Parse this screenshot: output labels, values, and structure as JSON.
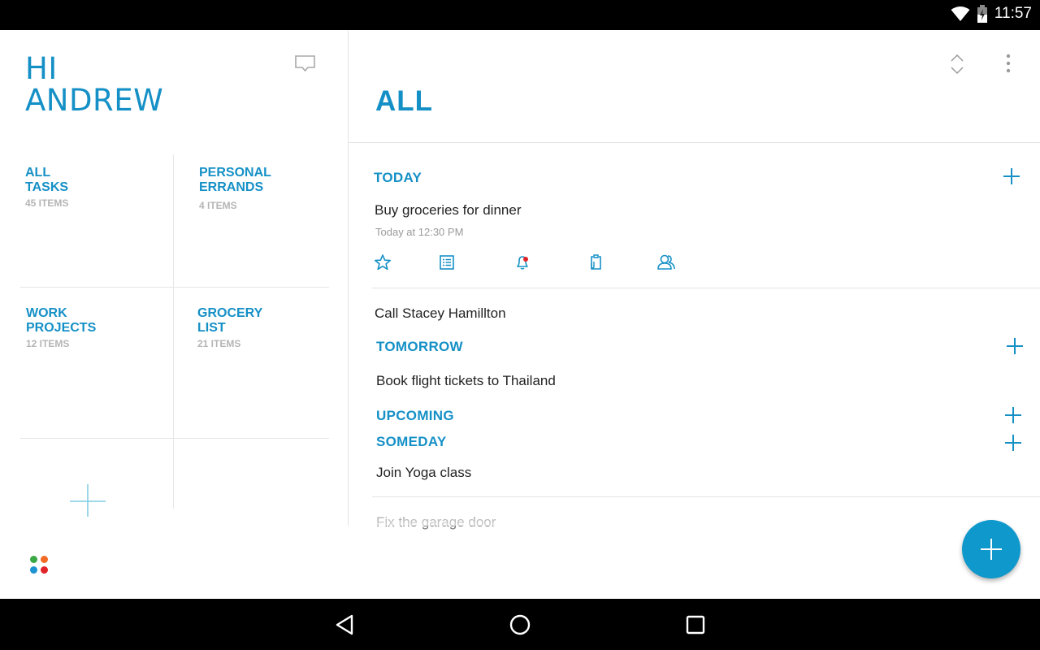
{
  "status_bar": {
    "time": "11:57",
    "icons": [
      "wifi-icon",
      "battery-charging-icon"
    ]
  },
  "sidebar": {
    "greeting": "HI\nANDREW",
    "chat_icon": "chat-bubble-icon",
    "lists": [
      {
        "title": "ALL\nTASKS",
        "count": "45 ITEMS"
      },
      {
        "title": "PERSONAL\nERRANDS",
        "count": "4 ITEMS"
      },
      {
        "title": "WORK\nPROJECTS",
        "count": "12 ITEMS"
      },
      {
        "title": "GROCERY\nLIST",
        "count": "21 ITEMS"
      }
    ],
    "add_list_icon": "plus-icon",
    "apps_icon": "four-dots-icon",
    "dot_colors": [
      "#3aa845",
      "#f26a26",
      "#1d93d2",
      "#e12228"
    ]
  },
  "main": {
    "title": "ALL",
    "header_icons": [
      "collapse-expand-icon",
      "more-vert-icon"
    ],
    "sections": [
      {
        "title": "TODAY"
      },
      {
        "title": "TOMORROW"
      },
      {
        "title": "UPCOMING"
      },
      {
        "title": "SOMEDAY"
      }
    ],
    "tasks": {
      "buy_groceries": {
        "title": "Buy groceries for dinner",
        "due": "Today at 12:30 PM"
      },
      "call_stacey": {
        "title": "Call Stacey Hamillton"
      },
      "book_flight": {
        "title": "Book flight tickets to Thailand"
      },
      "join_yoga": {
        "title": "Join Yoga class"
      },
      "fix_garage": {
        "title": "Fix the garage door"
      }
    },
    "task_actions": [
      "star-icon",
      "subtasks-icon",
      "reminder-icon",
      "attachment-icon",
      "share-icon"
    ],
    "fab_icon": "plus-icon"
  },
  "colors": {
    "accent": "#1590c6",
    "fab": "#0f98cc",
    "reminder_dot": "#e12228"
  },
  "nav_bar": {
    "buttons": [
      "back-icon",
      "home-icon",
      "recents-icon"
    ]
  }
}
